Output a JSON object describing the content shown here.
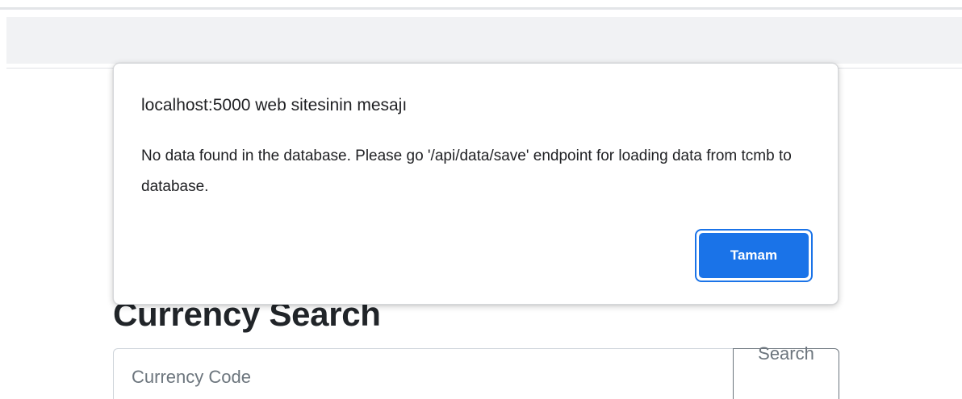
{
  "alert": {
    "title": "localhost:5000 web sitesinin mesajı",
    "message": "No data found in the database. Please go '/api/data/save' endpoint for loading data from tcmb to database.",
    "ok_label": "Tamam"
  },
  "main": {
    "title": "Currency Search",
    "search": {
      "value": "",
      "placeholder": "Currency Code",
      "button_label": "Search"
    }
  },
  "colors": {
    "accent": "#1a73e8",
    "navbar_bg": "#f1f2f4",
    "heading_text": "#212529",
    "muted_text": "#6c757d"
  }
}
